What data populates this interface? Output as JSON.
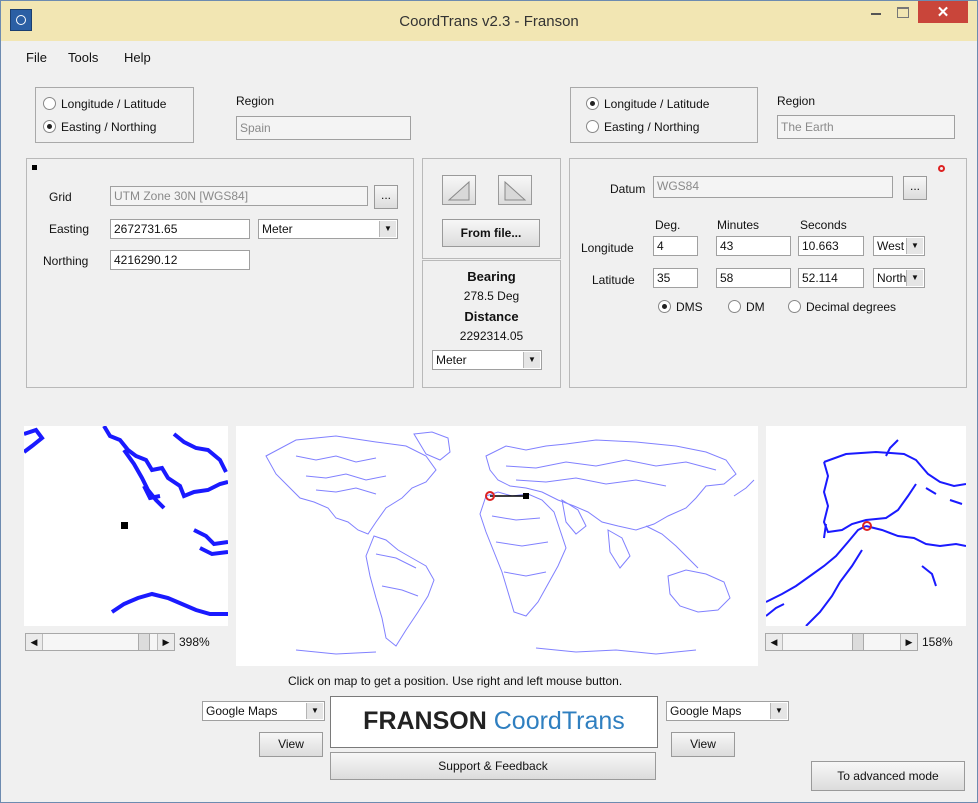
{
  "window": {
    "title": "CoordTrans v2.3 - Franson"
  },
  "menu": [
    "File",
    "Tools",
    "Help"
  ],
  "left": {
    "radio_lonlat": "Longitude / Latitude",
    "radio_easting": "Easting / Northing",
    "region_label": "Region",
    "region_value": "Spain",
    "grid_label": "Grid",
    "grid_value": "UTM Zone 30N [WGS84]",
    "grid_button": "...",
    "easting_label": "Easting",
    "easting_value": "2672731.65",
    "unit_value": "Meter",
    "northing_label": "Northing",
    "northing_value": "4216290.12"
  },
  "center": {
    "from_file": "From file...",
    "bearing_label": "Bearing",
    "bearing_value": "278.5 Deg",
    "distance_label": "Distance",
    "distance_value": "2292314.05",
    "unit_value": "Meter"
  },
  "right": {
    "radio_lonlat": "Longitude / Latitude",
    "radio_easting": "Easting / Northing",
    "region_label": "Region",
    "region_value": "The Earth",
    "datum_label": "Datum",
    "datum_value": "WGS84",
    "datum_button": "...",
    "col_deg": "Deg.",
    "col_min": "Minutes",
    "col_sec": "Seconds",
    "longitude_label": "Longitude",
    "lon_deg": "4",
    "lon_min": "43",
    "lon_sec": "10.663",
    "lon_dir": "West",
    "latitude_label": "Latitude",
    "lat_deg": "35",
    "lat_min": "58",
    "lat_sec": "52.114",
    "lat_dir": "North",
    "fmt_dms": "DMS",
    "fmt_dm": "DM",
    "fmt_dec": "Decimal degrees"
  },
  "maps": {
    "left_zoom": "398%",
    "right_zoom": "158%",
    "hint": "Click on map to get a position. Use right and left mouse button."
  },
  "footer": {
    "left_provider": "Google Maps",
    "left_view": "View",
    "right_provider": "Google Maps",
    "right_view": "View",
    "logo_a": "FRANSON",
    "logo_b": "CoordTrans",
    "support": "Support & Feedback",
    "advanced": "To advanced mode"
  },
  "colors": {
    "titlebar": "#f2e6b3",
    "close": "#c9453a",
    "map_line": "#1a1aff",
    "marker": "#dd2222",
    "logo_blue": "#2f7fc0"
  }
}
